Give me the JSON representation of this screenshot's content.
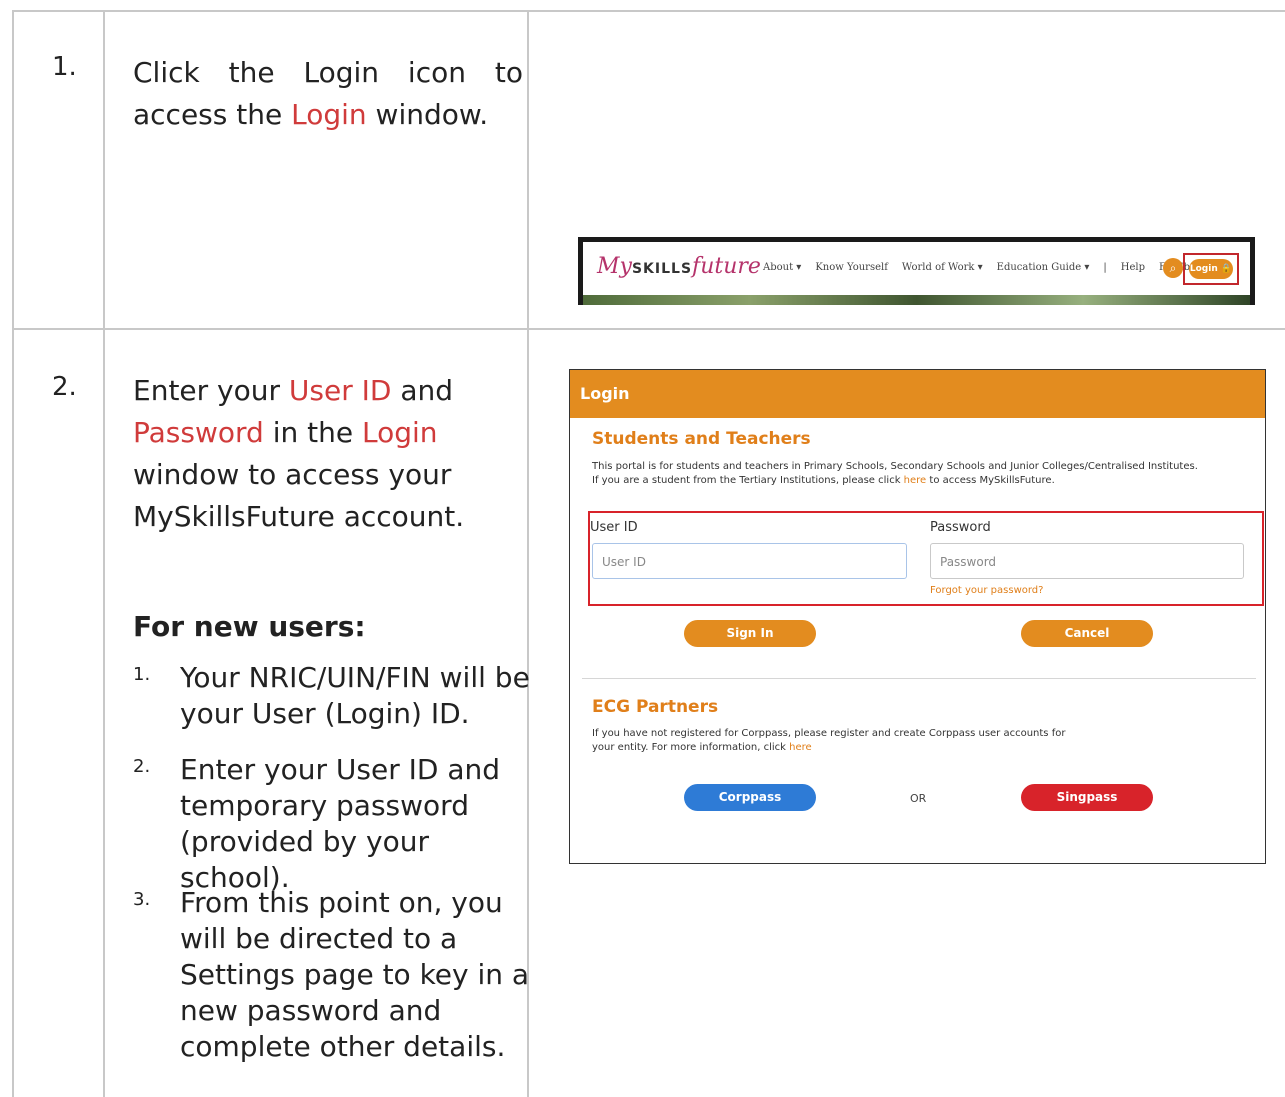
{
  "steps": [
    {
      "number": "1.",
      "text_before": "Click the Login icon to access the ",
      "highlight": "Login",
      "text_after": " window."
    },
    {
      "number": "2.",
      "p1": "Enter your ",
      "h1": "User ID",
      "p2": " and ",
      "h2": "Password",
      "p3": " in the ",
      "h3": "Login",
      "p4": " window to access your MySkillsFuture account."
    }
  ],
  "new_users": {
    "heading": "For new users:",
    "items": [
      {
        "n": "1.",
        "text": "Your NRIC/UIN/FIN will be your User (Login) ID."
      },
      {
        "n": "2.",
        "text": "Enter your User ID and temporary password (provided by your school)."
      },
      {
        "n": "3.",
        "text": "From this point on, you will be directed to a Settings page to key in a new password and complete other details."
      }
    ]
  },
  "navbar": {
    "logo_my": "My",
    "logo_skills": "SKILLS",
    "logo_future": "future",
    "items": [
      "About ▾",
      "Know Yourself",
      "World of Work ▾",
      "Education Guide ▾",
      "|",
      "Help",
      "Feedback"
    ],
    "search_icon": "search-icon",
    "login_label": "Login 🔒"
  },
  "login_panel": {
    "title": "Login",
    "students": {
      "heading": "Students and Teachers",
      "line1": "This portal is for students and teachers in Primary Schools, Secondary Schools and Junior Colleges/Centralised Institutes.",
      "line2_before": "If you are a student from the Tertiary Institutions, please click ",
      "line2_link": "here",
      "line2_after": " to access MySkillsFuture."
    },
    "user_id_label": "User ID",
    "user_id_placeholder": "User ID",
    "password_label": "Password",
    "password_placeholder": "Password",
    "forgot": "Forgot your password?",
    "sign_in": "Sign In",
    "cancel": "Cancel",
    "ecg": {
      "heading": "ECG Partners",
      "line1": "If you have not registered for Corppass, please register and create Corppass user accounts for",
      "line2_before": "your entity. For more information, click ",
      "line2_link": "here"
    },
    "corppass": "Corppass",
    "or": "OR",
    "singpass": "Singpass",
    "accent_color": "#e38c1f",
    "highlight_color": "#d8232a"
  }
}
